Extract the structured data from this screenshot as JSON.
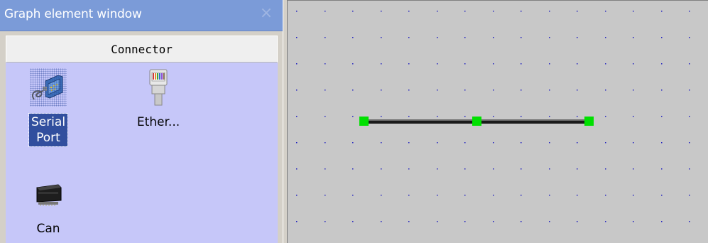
{
  "panel": {
    "title": "Graph element window",
    "close_glyph": "×",
    "category": "Connector",
    "tools": [
      {
        "label": "Serial\nPort",
        "icon": "serial-port-icon",
        "selected": true
      },
      {
        "label": "Ether...",
        "icon": "ethernet-icon",
        "selected": false
      },
      {
        "label": "Can",
        "icon": "can-connector-icon",
        "selected": false
      }
    ]
  },
  "canvas": {
    "background": "#c8c8c8",
    "grid_dot_color": "#1f1fbf",
    "connector_line_color": "#1a1a1a",
    "handle_color": "#00e000"
  },
  "colors": {
    "titlebar": "#7b9bd8",
    "panel_body": "#c6c7f9",
    "selection": "#314f9e"
  }
}
